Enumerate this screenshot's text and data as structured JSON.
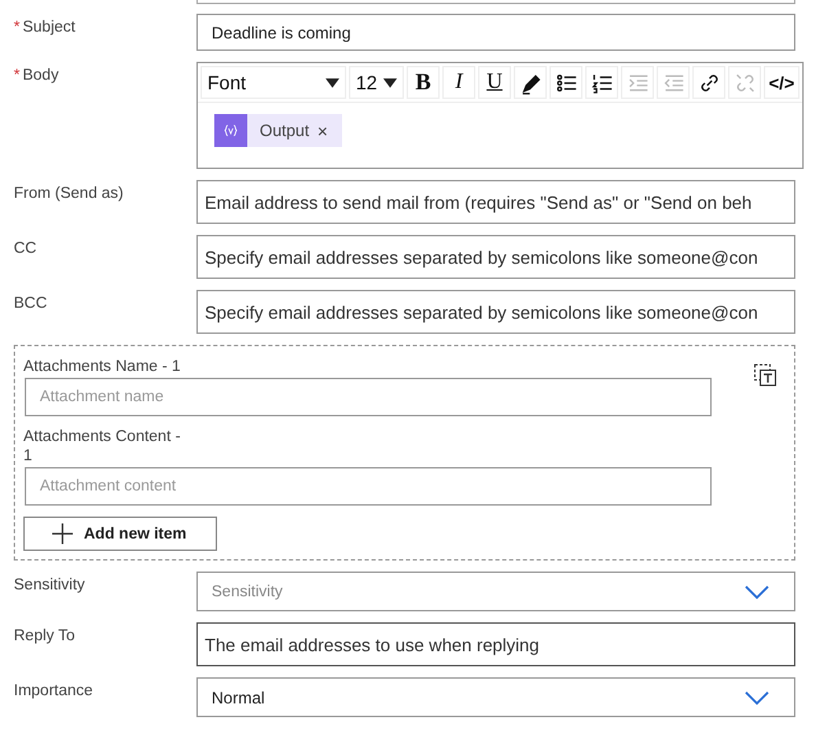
{
  "fields_top": [
    {
      "label": "Subject",
      "mark": "*",
      "value": "Deadline is coming"
    }
  ],
  "body": {
    "label": "Body",
    "mark": "*",
    "font": "Font",
    "size": "12",
    "tools": [
      {
        "kind": "bold",
        "label": "B",
        "disabled": false
      },
      {
        "kind": "italic",
        "label": "I",
        "disabled": false
      },
      {
        "kind": "underline",
        "label": "U",
        "disabled": false
      },
      {
        "kind": "pen",
        "disabled": false
      },
      {
        "kind": "bullets",
        "disabled": false
      },
      {
        "kind": "numbers",
        "disabled": false
      },
      {
        "kind": "indent",
        "disabled": true
      },
      {
        "kind": "outdent",
        "disabled": true
      },
      {
        "kind": "link",
        "disabled": false
      },
      {
        "kind": "unlink",
        "disabled": true
      },
      {
        "kind": "code",
        "label": "</>",
        "disabled": false
      }
    ],
    "token": {
      "label": "Output",
      "remove": "×"
    }
  },
  "fields_mid": [
    {
      "label": "From (Send as)",
      "placeholder": "Email address to send mail from (requires \"Send as\" or \"Send on beh"
    },
    {
      "label": "CC",
      "placeholder": "Specify email addresses separated by semicolons like someone@con"
    },
    {
      "label": "BCC",
      "placeholder": "Specify email addresses separated by semicolons like someone@con"
    }
  ],
  "attachments": {
    "items": [
      {
        "label": "Attachments Name - 1",
        "placeholder": "Attachment name"
      },
      {
        "label": "Attachments Content - 1",
        "placeholder": "Attachment content"
      }
    ],
    "add_button": "Add new item"
  },
  "fields_bottom": [
    {
      "kind": "dropdown",
      "label": "Sensitivity",
      "placeholder": "Sensitivity"
    },
    {
      "kind": "text",
      "label": "Reply To",
      "placeholder": "The email addresses to use when replying"
    },
    {
      "kind": "dropdown",
      "label": "Importance",
      "value": "Normal"
    }
  ]
}
